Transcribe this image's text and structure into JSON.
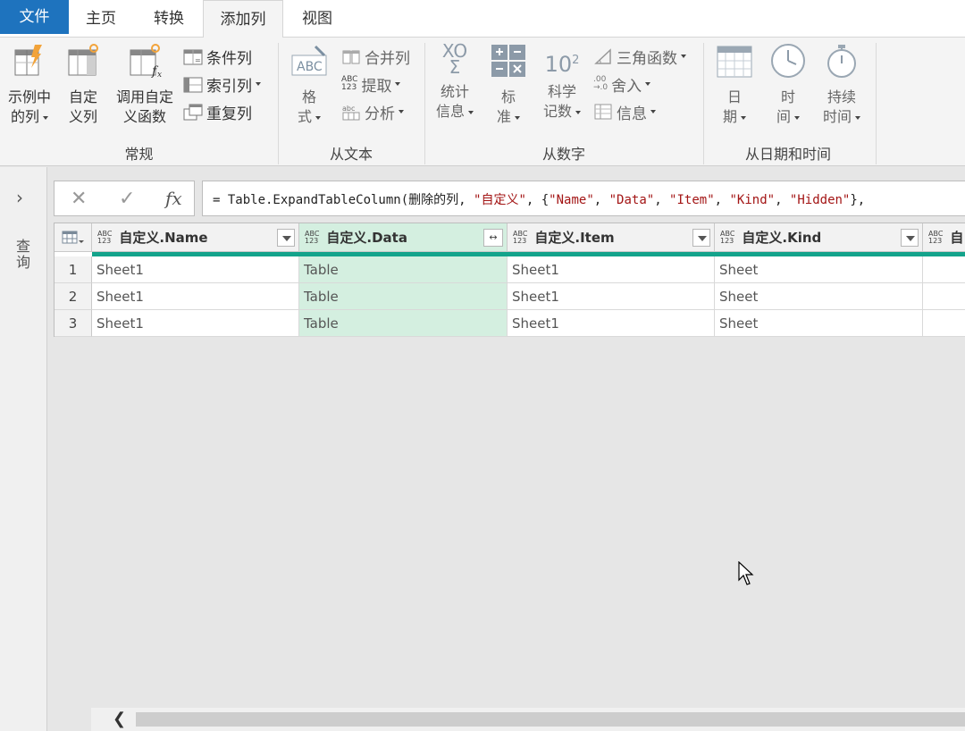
{
  "tabs": {
    "file": "文件",
    "home": "主页",
    "transform": "转换",
    "add_column": "添加列",
    "view": "视图"
  },
  "ribbon": {
    "general": {
      "label": "常规",
      "example_col": [
        "示例中",
        "的列"
      ],
      "custom_col": [
        "自定",
        "义列"
      ],
      "invoke_func": [
        "调用自定",
        "义函数"
      ],
      "conditional": "条件列",
      "index": "索引列",
      "duplicate": "重复列"
    },
    "from_text": {
      "label": "从文本",
      "format": [
        "格",
        "式"
      ],
      "merge": "合并列",
      "extract": "提取",
      "parse": "分析",
      "icon_text": "ABC"
    },
    "from_number": {
      "label": "从数字",
      "stats": [
        "统计",
        "信息"
      ],
      "standard": [
        "标",
        "准"
      ],
      "scientific": [
        "科学",
        "记数"
      ],
      "trig": "三角函数",
      "rounding": "舍入",
      "info": "信息",
      "stats_icon": [
        "XO",
        "Σ"
      ],
      "sci_icon": "10",
      "sci_sup": "2",
      "round_icon": [
        ".00",
        "→.0"
      ]
    },
    "from_datetime": {
      "label": "从日期和时间",
      "date": [
        "日",
        "期"
      ],
      "time": [
        "时",
        "间"
      ],
      "duration": [
        "持续",
        "时间"
      ]
    }
  },
  "query_pane": {
    "title": "查询"
  },
  "formula_bar": {
    "fx": "fx",
    "parts": {
      "prefix": "= Table.ExpandTableColumn(删除的列, ",
      "s1": "\"自定义\"",
      "mid": ", {",
      "s2": "\"Name\"",
      "c1": ", ",
      "s3": "\"Data\"",
      "c2": ", ",
      "s4": "\"Item\"",
      "c3": ", ",
      "s5": "\"Kind\"",
      "c4": ", ",
      "s6": "\"Hidden\"",
      "tail": "},"
    }
  },
  "grid": {
    "type_icon": [
      "ABC",
      "123"
    ],
    "columns": [
      {
        "label": "自定义.Name"
      },
      {
        "label": "自定义.Data"
      },
      {
        "label": "自定义.Item"
      },
      {
        "label": "自定义.Kind"
      },
      {
        "label": "自"
      }
    ],
    "rows": [
      {
        "num": "1",
        "cells": [
          "Sheet1",
          "Table",
          "Sheet1",
          "Sheet"
        ]
      },
      {
        "num": "2",
        "cells": [
          "Sheet1",
          "Table",
          "Sheet1",
          "Sheet"
        ]
      },
      {
        "num": "3",
        "cells": [
          "Sheet1",
          "Table",
          "Sheet1",
          "Sheet"
        ]
      }
    ]
  },
  "colors": {
    "file_tab": "#1e73be",
    "quality_bar": "#13a38b",
    "selected_column": "#d4efe0"
  }
}
